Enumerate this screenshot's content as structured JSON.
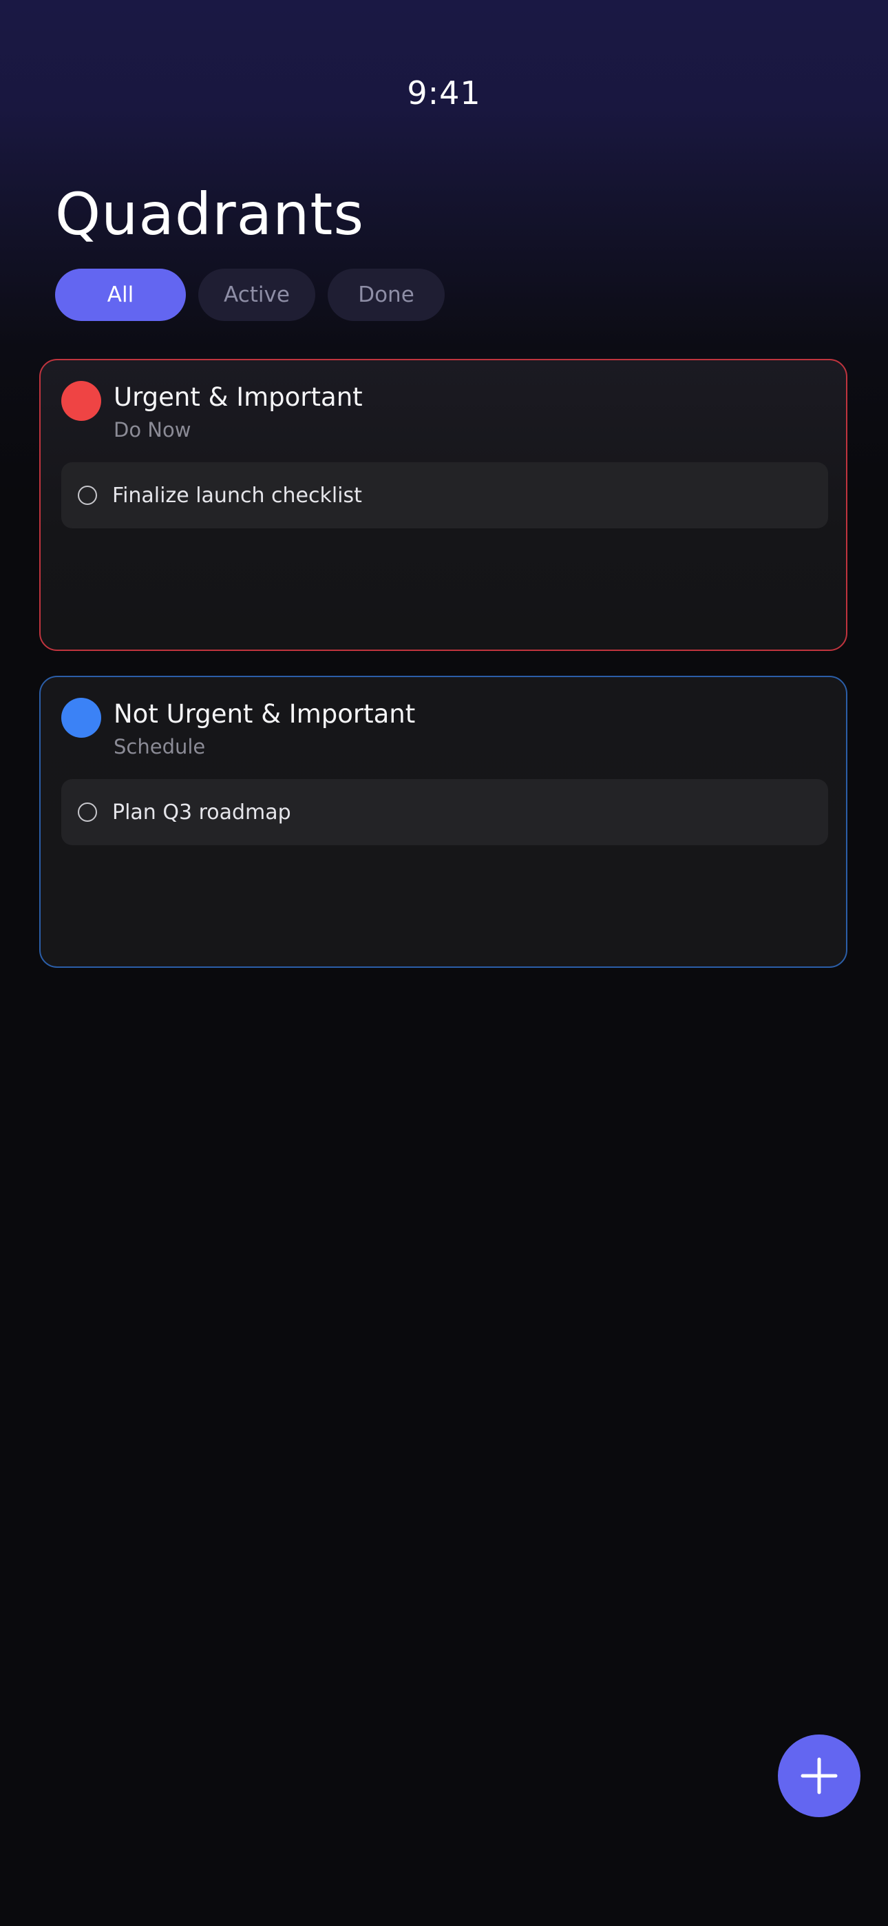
{
  "status_bar": {
    "time": "9:41"
  },
  "header": {
    "title": "Quadrants"
  },
  "filters": [
    {
      "label": "All",
      "selected": true
    },
    {
      "label": "Active",
      "selected": false
    },
    {
      "label": "Done",
      "selected": false
    }
  ],
  "quadrants": [
    {
      "title": "Urgent & Important",
      "subtitle": "Do Now",
      "color": "#ef4444",
      "border_color": "#c0343e",
      "tasks": [
        {
          "label": "Finalize launch checklist",
          "done": false
        }
      ]
    },
    {
      "title": "Not Urgent & Important",
      "subtitle": "Schedule",
      "color": "#3b82f6",
      "border_color": "#2b5ea8",
      "tasks": [
        {
          "label": "Plan Q3 roadmap",
          "done": false
        }
      ]
    }
  ],
  "fab": {
    "icon": "plus-icon",
    "color": "#6366f1"
  },
  "colors": {
    "accent": "#6366f1",
    "background": "#0a0a0d"
  }
}
